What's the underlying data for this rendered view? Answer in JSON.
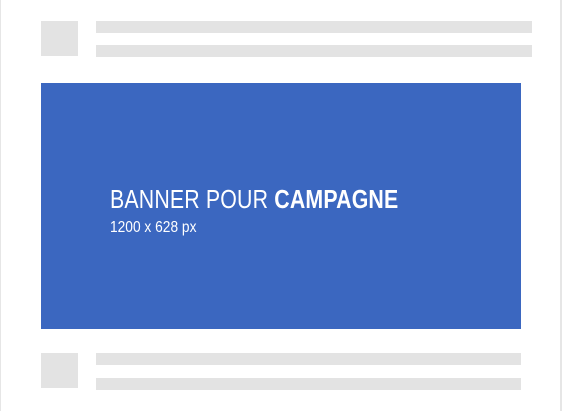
{
  "banner": {
    "title_regular": "BANNER POUR",
    "title_bold": "CAMPAGNE",
    "dimensions": "1200 x 628 px",
    "color": "#3b67c0"
  },
  "placeholder_color": "#e3e3e3"
}
